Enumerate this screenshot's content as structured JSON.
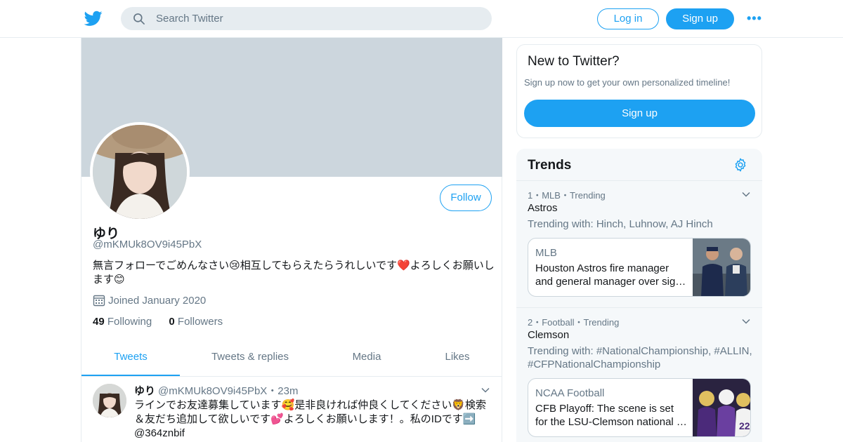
{
  "header": {
    "search_placeholder": "Search Twitter",
    "login_label": "Log in",
    "signup_label": "Sign up",
    "more_label": "•••"
  },
  "profile": {
    "display_name": "ゆり",
    "handle": "@mKMUk8OV9i45PbX",
    "bio": "無言フォローでごめんなさい😢相互してもらえたらうれしいです❤️よろしくお願いします😊",
    "joined": "Joined January 2020",
    "follow_label": "Follow",
    "following_count": "49",
    "following_label": "Following",
    "followers_count": "0",
    "followers_label": "Followers"
  },
  "tabs": [
    {
      "label": "Tweets",
      "active": true
    },
    {
      "label": "Tweets & replies",
      "active": false
    },
    {
      "label": "Media",
      "active": false
    },
    {
      "label": "Likes",
      "active": false
    }
  ],
  "tweet": {
    "name": "ゆり",
    "handle_time": "@mKMUk8OV9i45PbX・23m",
    "text": "ラインでお友達募集しています🥰是非良ければ仲良くしてください🦁検索＆友だち追加して欲しいです💕よろしくお願いします！。私のIDです➡️ @364znbif"
  },
  "signup_box": {
    "title": "New to Twitter?",
    "subtitle": "Sign up now to get your own personalized timeline!",
    "button": "Sign up"
  },
  "trends": {
    "title": "Trends",
    "items": [
      {
        "meta": "1・MLB・Trending",
        "name": "Astros",
        "with": "Trending with: Hinch, Luhnow, AJ Hinch",
        "card_source": "MLB",
        "card_headline": "Houston Astros fire manager and general manager over sig…"
      },
      {
        "meta": "2・Football・Trending",
        "name": "Clemson",
        "with": "Trending with: #NationalChampionship, #ALLIN, #CFPNationalChampionship",
        "card_source": "NCAA Football",
        "card_headline": "CFB Playoff: The scene is set for the LSU-Clemson national …"
      }
    ]
  },
  "colors": {
    "accent": "#1da1f2",
    "banner": "#ccd6dd",
    "muted_text": "#657786",
    "trends_bg": "#f5f8fa"
  }
}
